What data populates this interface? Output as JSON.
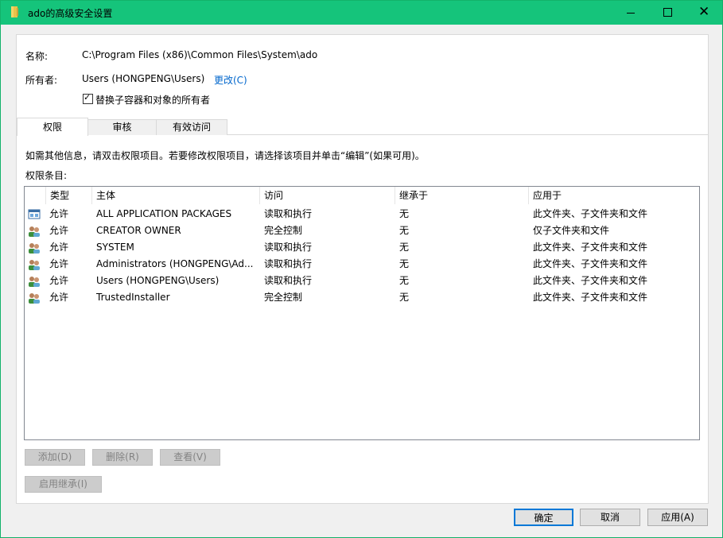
{
  "window": {
    "title": "ado的高级安全设置",
    "title_icon": "folder-icon",
    "titlebar_color": "#15c47b",
    "controls": {
      "minimize": "minimize-icon",
      "maximize": "maximize-icon",
      "close": "✕"
    }
  },
  "header": {
    "name_label": "名称:",
    "name_value": "C:\\Program Files (x86)\\Common Files\\System\\ado",
    "owner_label": "所有者:",
    "owner_value": "Users (HONGPENG\\Users)",
    "change_link": "更改(C)",
    "replace_owner_label": "替换子容器和对象的所有者",
    "replace_owner_checked": true,
    "checkmark": "✓"
  },
  "tabs": [
    {
      "label": "权限",
      "selected": true
    },
    {
      "label": "审核",
      "selected": false
    },
    {
      "label": "有效访问",
      "selected": false
    }
  ],
  "permissions": {
    "info_text": "如需其他信息，请双击权限项目。若要修改权限项目，请选择该项目并单击“编辑”(如果可用)。",
    "entries_label": "权限条目:",
    "columns": [
      "类型",
      "主体",
      "访问",
      "继承于",
      "应用于"
    ],
    "rows": [
      {
        "icon": "app-packages-icon",
        "type": "允许",
        "principal": "ALL APPLICATION PACKAGES",
        "access": "读取和执行",
        "inherited": "无",
        "applies": "此文件夹、子文件夹和文件"
      },
      {
        "icon": "users-icon",
        "type": "允许",
        "principal": "CREATOR OWNER",
        "access": "完全控制",
        "inherited": "无",
        "applies": "仅子文件夹和文件"
      },
      {
        "icon": "users-icon",
        "type": "允许",
        "principal": "SYSTEM",
        "access": "读取和执行",
        "inherited": "无",
        "applies": "此文件夹、子文件夹和文件"
      },
      {
        "icon": "users-icon",
        "type": "允许",
        "principal": "Administrators (HONGPENG\\Ad...",
        "access": "读取和执行",
        "inherited": "无",
        "applies": "此文件夹、子文件夹和文件"
      },
      {
        "icon": "users-icon",
        "type": "允许",
        "principal": "Users (HONGPENG\\Users)",
        "access": "读取和执行",
        "inherited": "无",
        "applies": "此文件夹、子文件夹和文件"
      },
      {
        "icon": "users-icon",
        "type": "允许",
        "principal": "TrustedInstaller",
        "access": "完全控制",
        "inherited": "无",
        "applies": "此文件夹、子文件夹和文件"
      }
    ]
  },
  "actions": {
    "add": "添加(D)",
    "remove": "删除(R)",
    "view": "查看(V)",
    "enable_inheritance": "启用继承(I)"
  },
  "footer": {
    "ok": "确定",
    "cancel": "取消",
    "apply": "应用(A)",
    "ok_border_color": "#0078d7"
  }
}
